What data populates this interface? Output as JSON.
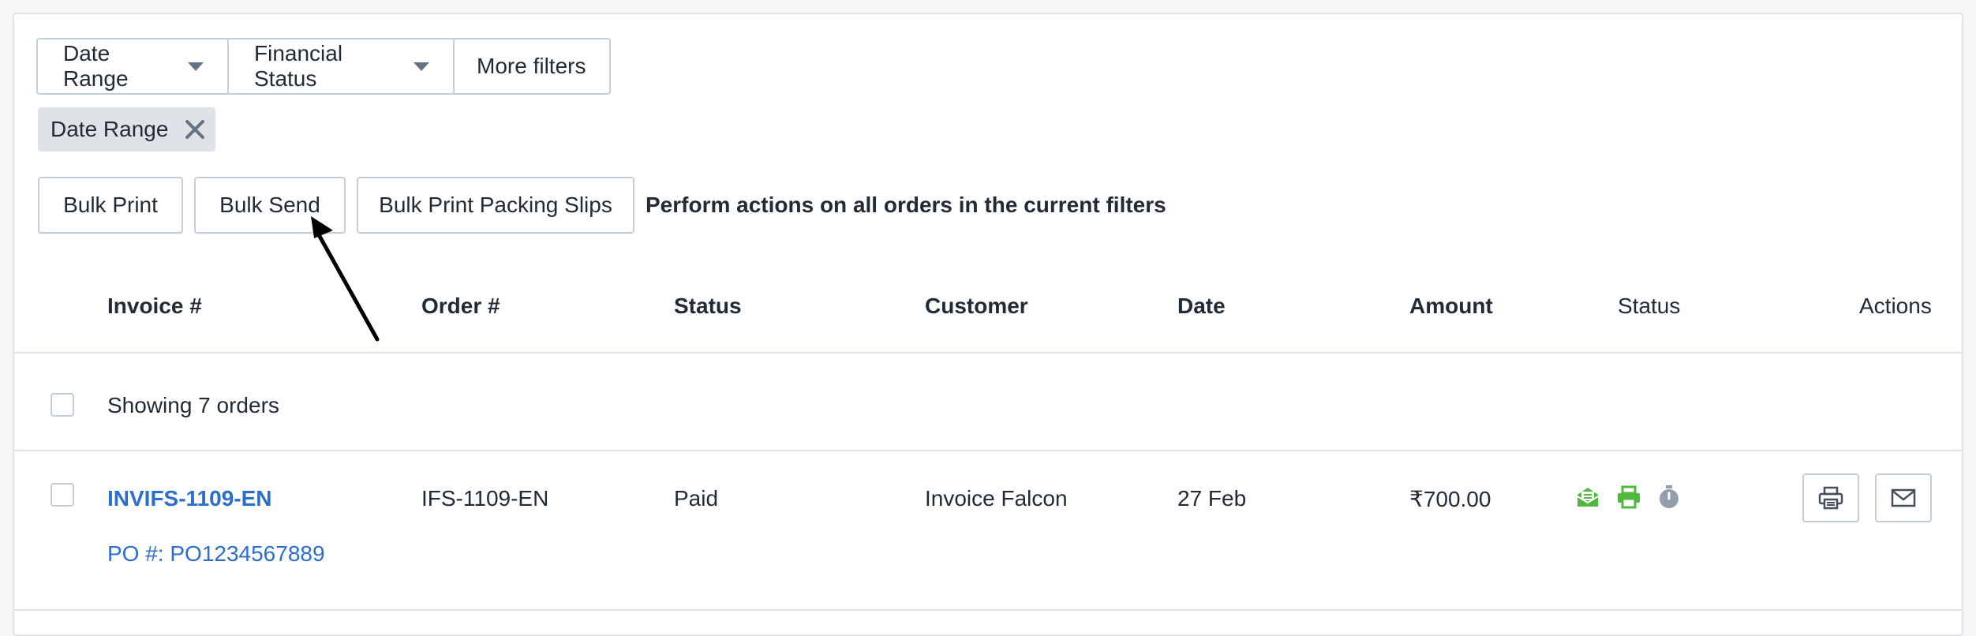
{
  "filters": {
    "date_range_label": "Date Range",
    "financial_status_label": "Financial Status",
    "more_filters_label": "More filters"
  },
  "applied_tag": {
    "label": "Date Range"
  },
  "bulk_actions": {
    "bulk_print_label": "Bulk Print",
    "bulk_send_label": "Bulk Send",
    "bulk_print_packing_label": "Bulk Print Packing Slips",
    "note": "Perform actions on all orders in the current filters"
  },
  "table": {
    "headers": {
      "invoice": "Invoice #",
      "order": "Order #",
      "status": "Status",
      "customer": "Customer",
      "date": "Date",
      "amount": "Amount",
      "status2": "Status",
      "actions": "Actions"
    },
    "showing_text": "Showing 7 orders",
    "rows": [
      {
        "invoice": "INVIFS-1109-EN",
        "po": "PO #: PO1234567889",
        "order": "IFS-1109-EN",
        "status": "Paid",
        "customer": "Invoice Falcon",
        "date": "27 Feb",
        "amount": "₹700.00"
      }
    ]
  },
  "icons": {
    "email_sent": "envelope-open-icon",
    "printed": "printer-icon",
    "scheduled": "stopwatch-icon",
    "print_action": "printer-icon",
    "email_action": "envelope-icon"
  },
  "colors": {
    "link": "#2c6ecb",
    "success_green": "#50b83c",
    "muted_gray": "#919eab",
    "border": "#c4cdd5"
  }
}
